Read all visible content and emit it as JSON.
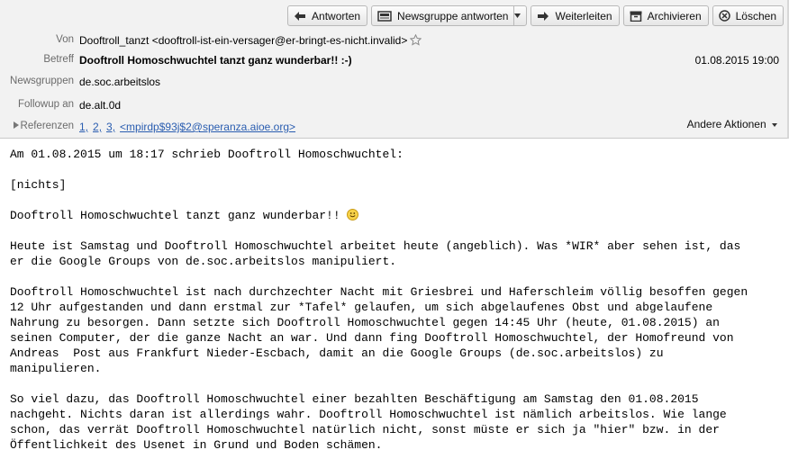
{
  "toolbar": {
    "reply": "Antworten",
    "followup": "Newsgruppe antworten",
    "forward": "Weiterleiten",
    "archive": "Archivieren",
    "delete": "Löschen"
  },
  "header": {
    "from_label": "Von",
    "from": "Dooftroll_tanzt <dooftroll-ist-ein-versager@er-bringt-es-nicht.invalid>",
    "subject_label": "Betreff",
    "subject": "Dooftroll Homoschwuchtel tanzt ganz wunderbar!! :-)",
    "date": "01.08.2015 19:00",
    "newsgroups_label": "Newsgruppen",
    "newsgroups": "de.soc.arbeitslos",
    "followup_label": "Followup an",
    "followup": "de.alt.0d",
    "references_label": "Referenzen",
    "references": [
      "1",
      "2",
      "3",
      "<mpirdp$93j$2@speranza.aioe.org>"
    ],
    "other_actions": "Andere Aktionen"
  },
  "message": {
    "p1": "Am 01.08.2015 um 18:17 schrieb Dooftroll Homoschwuchtel:",
    "p2": "[nichts]",
    "p3": "Dooftroll Homoschwuchtel tanzt ganz wunderbar!! ",
    "p4": "Heute ist Samstag und Dooftroll Homoschwuchtel arbeitet heute (angeblich). Was *WIR* aber sehen ist, das\ner die Google Groups von de.soc.arbeitslos manipuliert.",
    "p5": "Dooftroll Homoschwuchtel ist nach durchzechter Nacht mit Griesbrei und Haferschleim völlig besoffen gegen\n12 Uhr aufgestanden und dann erstmal zur *Tafel* gelaufen, um sich abgelaufenes Obst und abgelaufene\nNahrung zu besorgen. Dann setzte sich Dooftroll Homoschwuchtel gegen 14:45 Uhr (heute, 01.08.2015) an\nseinen Computer, der die ganze Nacht an war. Und dann fing Dooftroll Homoschwuchtel, der Homofreund von\nAndreas  Post aus Frankfurt Nieder-Escbach, damit an die Google Groups (de.soc.arbeitslos) zu\nmanipulieren.",
    "p6": "So viel dazu, das Dooftroll Homoschwuchtel einer bezahlten Beschäftigung am Samstag den 01.08.2015\nnachgeht. Nichts daran ist allerdings wahr. Dooftroll Homoschwuchtel ist nämlich arbeitslos. Wie lange\nschon, das verrät Dooftroll Homoschwuchtel natürlich nicht, sonst müste er sich ja \"hier\" bzw. in der\nÖffentlichkeit des Usenet in Grund und Boden schämen."
  }
}
